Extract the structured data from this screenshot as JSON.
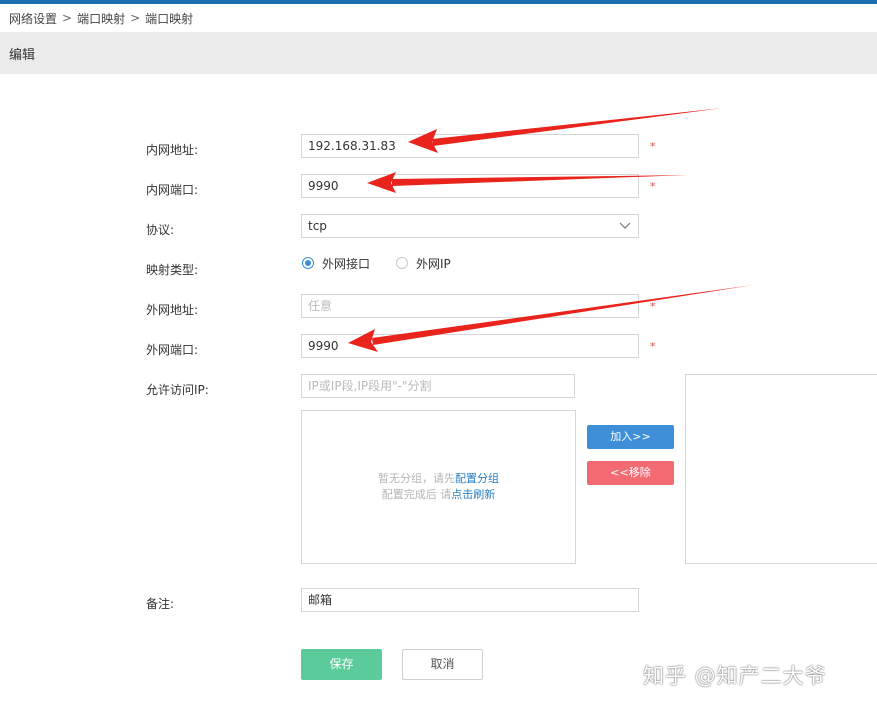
{
  "breadcrumb": [
    "网络设置",
    "端口映射",
    "端口映射"
  ],
  "breadcrumb_separator": ">",
  "section_title": "编辑",
  "form": {
    "internal_address": {
      "label": "内网地址:",
      "value": "192.168.31.83",
      "required_mark": "*"
    },
    "internal_port": {
      "label": "内网端口:",
      "value": "9990",
      "required_mark": "*"
    },
    "protocol": {
      "label": "协议:",
      "value": "tcp"
    },
    "mapping_type": {
      "label": "映射类型:",
      "options": [
        "外网接口",
        "外网IP"
      ],
      "selected": "外网接口"
    },
    "external_address": {
      "label": "外网地址:",
      "placeholder": "任意",
      "required_mark": "*"
    },
    "external_port": {
      "label": "外网端口:",
      "value": "9990",
      "required_mark": "*"
    },
    "allowed_ip": {
      "label": "允许访问IP:",
      "placeholder": "IP或IP段,IP段用\"-\"分割",
      "empty_line1_prefix": "暂无分组，请先",
      "empty_line1_link": "配置分组",
      "empty_line2_prefix": "配置完成后 请",
      "empty_line2_link": "点击刷新",
      "add_button": "加入>>",
      "remove_button": "<<移除"
    },
    "note": {
      "label": "备注:",
      "value": "邮箱"
    }
  },
  "actions": {
    "save": "保存",
    "cancel": "取消"
  },
  "watermark": "知乎 @知产二大爷",
  "colors": {
    "accent_blue": "#3f8fd8",
    "remove_red": "#f26b73",
    "save_green": "#5ccb9b",
    "required_red": "#e84a4a",
    "arrow_red": "#e8241c",
    "top_bar": "#1e6fb0"
  },
  "icons": {
    "protocol_dropdown": "chevron-down-icon"
  }
}
